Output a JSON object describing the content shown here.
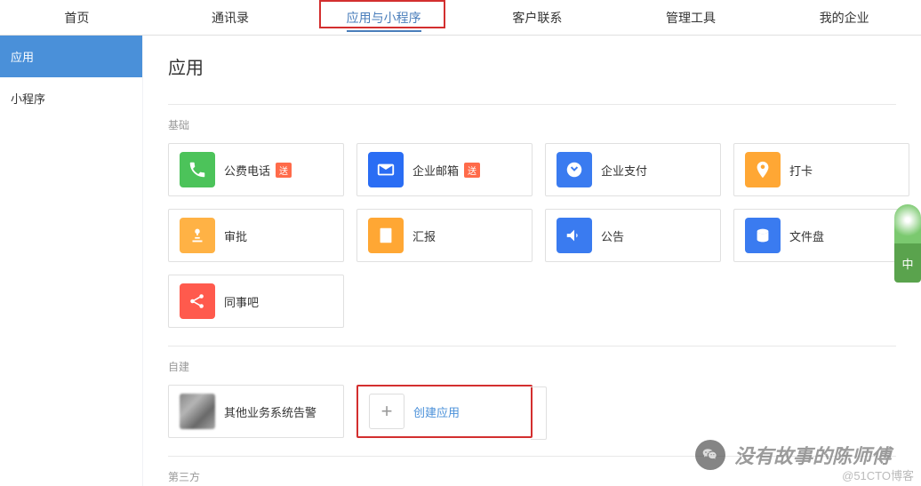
{
  "nav": {
    "items": [
      "首页",
      "通讯录",
      "应用与小程序",
      "客户联系",
      "管理工具",
      "我的企业"
    ],
    "active_index": 2
  },
  "sidebar": {
    "items": [
      "应用",
      "小程序"
    ],
    "active_index": 0
  },
  "page_title": "应用",
  "sections": {
    "basic": {
      "label": "基础",
      "apps": [
        {
          "name": "公费电话",
          "badge": "送",
          "icon": "phone",
          "color": "#4cc35a"
        },
        {
          "name": "企业邮箱",
          "badge": "送",
          "icon": "mail",
          "color": "#2a6df4"
        },
        {
          "name": "企业支付",
          "badge": "",
          "icon": "pay",
          "color": "#3a7bf0"
        },
        {
          "name": "打卡",
          "badge": "",
          "icon": "pin",
          "color": "#ffa734"
        },
        {
          "name": "审批",
          "badge": "",
          "icon": "stamp",
          "color": "#ffb245"
        },
        {
          "name": "汇报",
          "badge": "",
          "icon": "report",
          "color": "#ffa734"
        },
        {
          "name": "公告",
          "badge": "",
          "icon": "announce",
          "color": "#3a7bf0"
        },
        {
          "name": "文件盘",
          "badge": "",
          "icon": "disk",
          "color": "#3a7bf0"
        },
        {
          "name": "同事吧",
          "badge": "",
          "icon": "share",
          "color": "#ff5a4d"
        }
      ]
    },
    "custom": {
      "label": "自建",
      "apps": [
        {
          "name": "其他业务系统告警",
          "icon": "avatar"
        }
      ],
      "create_label": "创建应用"
    },
    "third": {
      "label": "第三方"
    }
  },
  "watermark": {
    "wechat_text": "没有故事的陈师傅",
    "blog_text": "@51CTO博客"
  },
  "floating": {
    "char": "中"
  }
}
